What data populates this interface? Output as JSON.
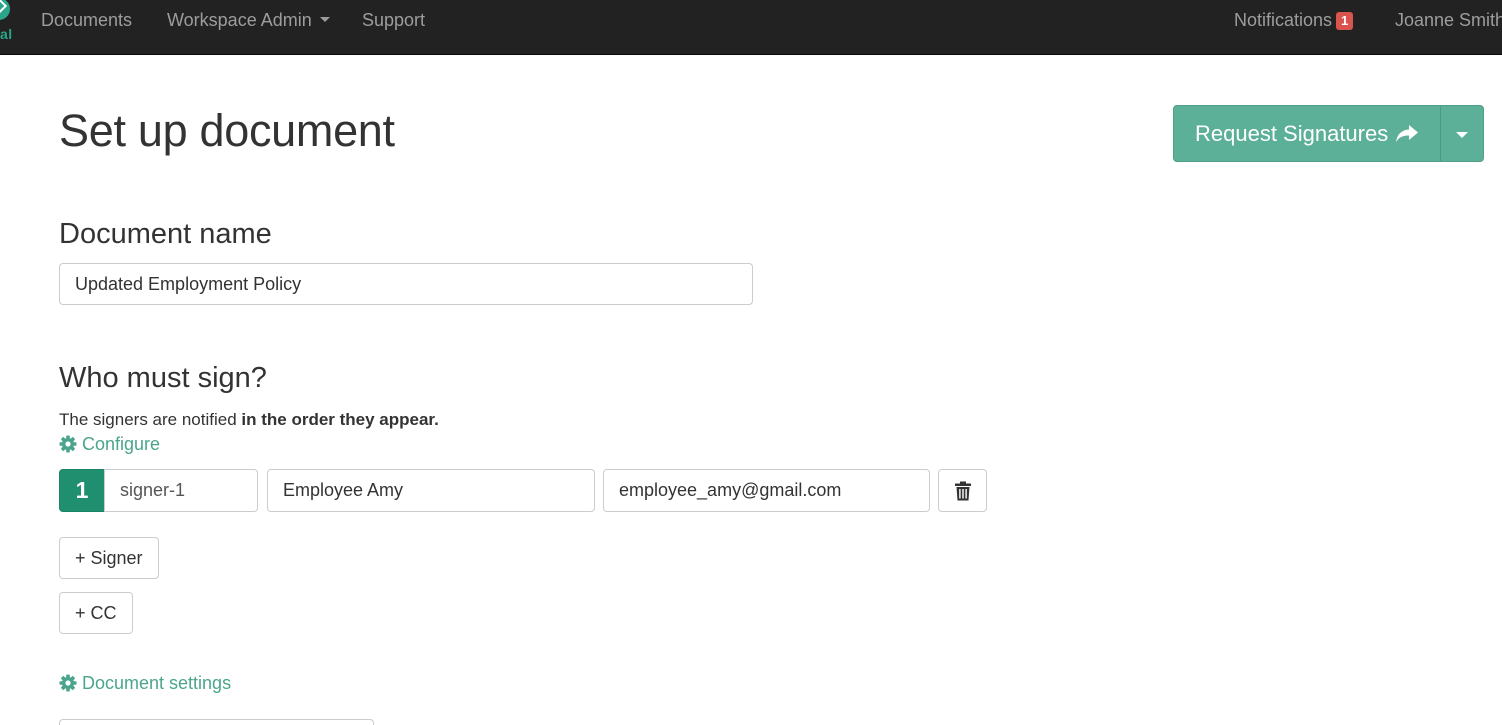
{
  "navbar": {
    "brand_text": "al",
    "links": {
      "documents": "Documents",
      "workspace_admin": "Workspace Admin",
      "support": "Support"
    },
    "notifications_label": "Notifications",
    "notifications_count": "1",
    "user_name": "Joanne Smith"
  },
  "page": {
    "title": "Set up document",
    "request_button_label": "Request Signatures"
  },
  "document_name": {
    "heading": "Document name",
    "value": "Updated Employment Policy"
  },
  "signers": {
    "heading": "Who must sign?",
    "help_prefix": "The signers are notified ",
    "help_bold": "in the order they appear.",
    "configure_label": "Configure",
    "rows": [
      {
        "order": "1",
        "role": "signer-1",
        "name": "Employee Amy",
        "email": "employee_amy@gmail.com"
      }
    ],
    "add_signer_label": "+ Signer",
    "add_cc_label": "+ CC"
  },
  "settings": {
    "document_settings_label": "Document settings"
  },
  "colors": {
    "navbar_bg": "#222222",
    "accent": "#5cb098",
    "order_badge": "#1f8f70",
    "link": "#4aa58c",
    "notification_badge": "#d9534f"
  }
}
